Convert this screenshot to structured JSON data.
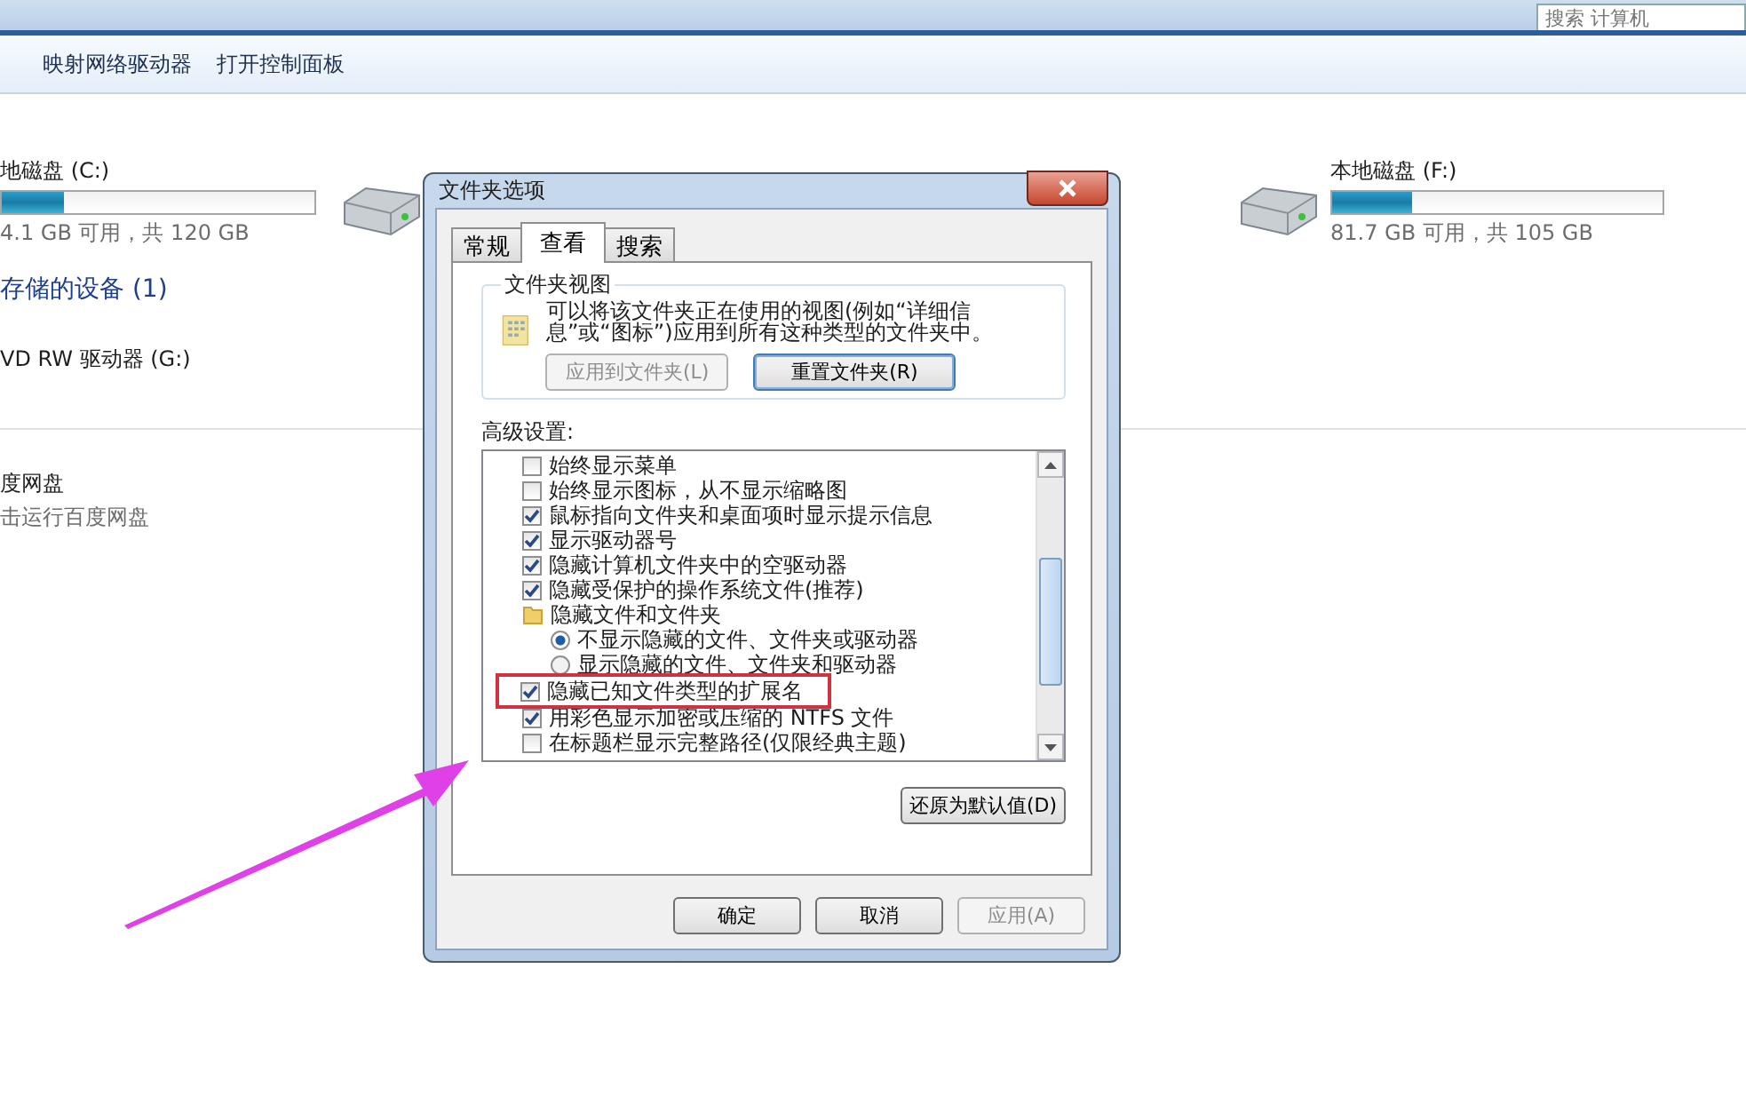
{
  "search": {
    "placeholder": "搜索 计算机"
  },
  "toolbar": [
    "映射网络驱动器",
    "打开控制面板"
  ],
  "drives": [
    {
      "icon": false,
      "name": "地磁盘 (C:)",
      "level": 0.2,
      "free": "4.1 GB 可用，共 120 GB"
    },
    {
      "icon": true
    },
    {
      "icon": true,
      "name": "本地磁盘 (F:)",
      "level": 0.24,
      "free": "81.7 GB 可用，共 105 GB"
    }
  ],
  "devices": {
    "heading": "存储的设备 (1)",
    "items": [
      "VD RW 驱动器 (G:)"
    ]
  },
  "other": {
    "name": "度网盘",
    "description": "击运行百度网盘"
  },
  "dialog": {
    "title": "文件夹选项",
    "tabs": [
      {
        "label": "常规",
        "selected": false
      },
      {
        "label": "查看",
        "selected": true
      },
      {
        "label": "搜索",
        "selected": false
      }
    ],
    "folder_views": {
      "title": "文件夹视图",
      "description": "可以将该文件夹正在使用的视图(例如“详细信息”或“图标”)应用到所有这种类型的文件夹中。",
      "buttons": [
        {
          "label": "应用到文件夹(L)",
          "disabled": true
        },
        {
          "label": "重置文件夹(R)",
          "disabled": false
        }
      ]
    },
    "advanced_label": "高级设置:",
    "settings": [
      {
        "kind": "checkbox",
        "label": "始终显示菜单",
        "checked": false,
        "highlighted": false
      },
      {
        "kind": "checkbox",
        "label": "始终显示图标，从不显示缩略图",
        "checked": false,
        "highlighted": false
      },
      {
        "kind": "checkbox",
        "label": "鼠标指向文件夹和桌面项时显示提示信息",
        "checked": true,
        "highlighted": false
      },
      {
        "kind": "checkbox",
        "label": "显示驱动器号",
        "checked": true,
        "highlighted": false
      },
      {
        "kind": "checkbox",
        "label": "隐藏计算机文件夹中的空驱动器",
        "checked": true,
        "highlighted": false
      },
      {
        "kind": "checkbox",
        "label": "隐藏受保护的操作系统文件(推荐)",
        "checked": true,
        "highlighted": false
      },
      {
        "kind": "folder",
        "label": "隐藏文件和文件夹",
        "highlighted": false,
        "children": [
          {
            "kind": "radio",
            "label": "不显示隐藏的文件、文件夹或驱动器",
            "selected": true
          },
          {
            "kind": "radio",
            "label": "显示隐藏的文件、文件夹和驱动器",
            "selected": false
          }
        ]
      },
      {
        "kind": "checkbox",
        "label": "隐藏已知文件类型的扩展名",
        "checked": true,
        "highlighted": true
      },
      {
        "kind": "checkbox",
        "label": "用彩色显示加密或压缩的 NTFS 文件",
        "checked": true,
        "highlighted": false
      },
      {
        "kind": "checkbox",
        "label": "在标题栏显示完整路径(仅限经典主题)",
        "checked": false,
        "highlighted": false
      }
    ],
    "restore_button": "还原为默认值(D)",
    "footer_buttons": [
      {
        "label": "确定",
        "disabled": false
      },
      {
        "label": "取消",
        "disabled": false
      },
      {
        "label": "应用(A)",
        "disabled": true
      }
    ]
  }
}
